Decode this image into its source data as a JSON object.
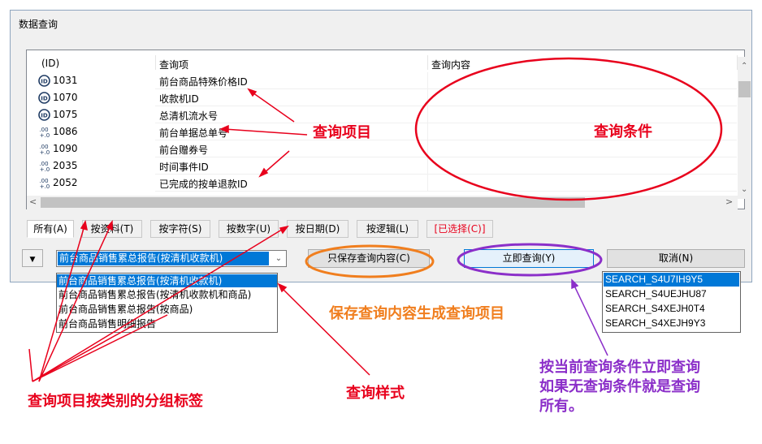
{
  "window": {
    "title": "数据查询"
  },
  "list": {
    "columns": [
      "(ID)",
      "查询项",
      "查询内容"
    ],
    "rows": [
      {
        "id": "1031",
        "name": "前台商品特殊价格ID",
        "icon": "id-icon"
      },
      {
        "id": "1070",
        "name": "收款机ID",
        "icon": "id-icon"
      },
      {
        "id": "1075",
        "name": "总清机流水号",
        "icon": "id-icon"
      },
      {
        "id": "1086",
        "name": "前台单据总单号",
        "icon": "number-icon"
      },
      {
        "id": "1090",
        "name": "前台赠券号",
        "icon": "number-icon"
      },
      {
        "id": "2035",
        "name": "时间事件ID",
        "icon": "number-icon"
      },
      {
        "id": "2052",
        "name": "已完成的按单退款ID",
        "icon": "number-icon"
      }
    ]
  },
  "tabs": [
    {
      "label": "所有(A)",
      "active": true
    },
    {
      "label": "按资料(T)"
    },
    {
      "label": "按字符(S)"
    },
    {
      "label": "按数字(U)"
    },
    {
      "label": "按日期(D)"
    },
    {
      "label": "按逻辑(L)"
    },
    {
      "label": "[已选择(C)]"
    }
  ],
  "style_select": {
    "value": "前台商品销售累总报告(按清机收款机)",
    "options": [
      "前台商品销售累总报告(按清机收款机)",
      "前台商品销售累总报告(按清机收款机和商品)",
      "前台商品销售累总报告(按商品)",
      "前台商品销售明细报告"
    ]
  },
  "buttons": {
    "save": "只保存查询内容(C)",
    "query": "立即查询(Y)",
    "cancel": "取消(N)"
  },
  "saved_queries": [
    "SEARCH_S4U7IH9Y5",
    "SEARCH_S4UEJHU87",
    "SEARCH_S4XEJH0T4",
    "SEARCH_S4XEJH9Y3"
  ],
  "annotations": {
    "query_items": "查询项目",
    "query_conditions": "查询条件",
    "save_note": "保存查询内容生成查询项目",
    "group_tabs": "查询项目按类别的分组标签",
    "query_style": "查询样式",
    "query_now_line1": "按当前查询条件立即查询",
    "query_now_line2": "如果无查询条件就是查询",
    "query_now_line3": "所有。"
  },
  "colors": {
    "annotation_red": "#e8001c",
    "annotation_orange": "#f07e1e",
    "annotation_purple": "#8b2fc9",
    "selection_blue": "#0078d7"
  }
}
